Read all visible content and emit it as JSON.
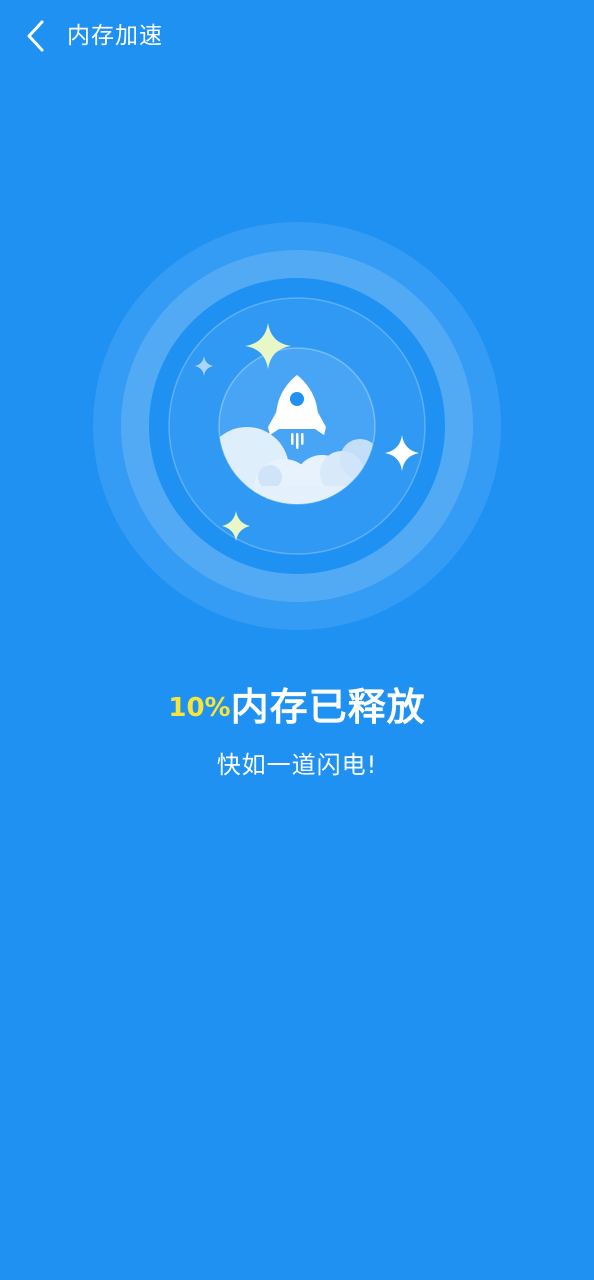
{
  "header": {
    "back_icon": "chevron-left-icon",
    "title": "内存加速"
  },
  "hero": {
    "icon": "rocket-icon",
    "decorations": [
      "sparkle-icon",
      "cloud-icon"
    ],
    "colors": {
      "background": "#1e91f3",
      "sparkle_accent": "#e8f7c8"
    }
  },
  "result": {
    "percent": "10%",
    "headline": "内存已释放",
    "subtitle": "快如一道闪电!",
    "percent_color": "#f7e53a"
  }
}
